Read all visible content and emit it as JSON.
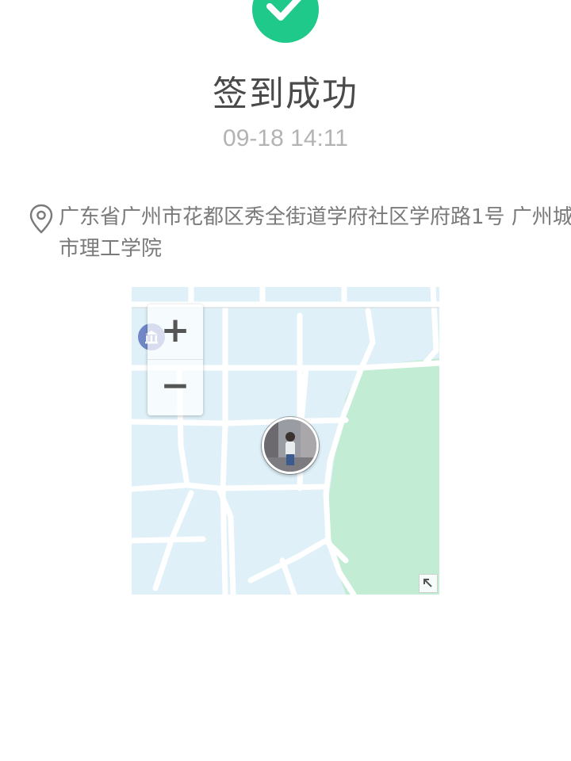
{
  "status": {
    "title": "签到成功",
    "time": "09-18 14:11",
    "accent_color": "#1ec98a",
    "icon": "check-icon"
  },
  "location": {
    "icon": "location-pin-icon",
    "address": "广东省广州市花都区秀全街道学府社区学府路1号 广州城市理工学院"
  },
  "map": {
    "zoom_in_label": "+",
    "zoom_out_label": "−",
    "marker": "user-avatar-marker",
    "poi_icon": "bank-icon",
    "expand_icon": "expand-arrow-icon",
    "water_color": "#dff0f8",
    "park_color": "#c3ecd4"
  }
}
